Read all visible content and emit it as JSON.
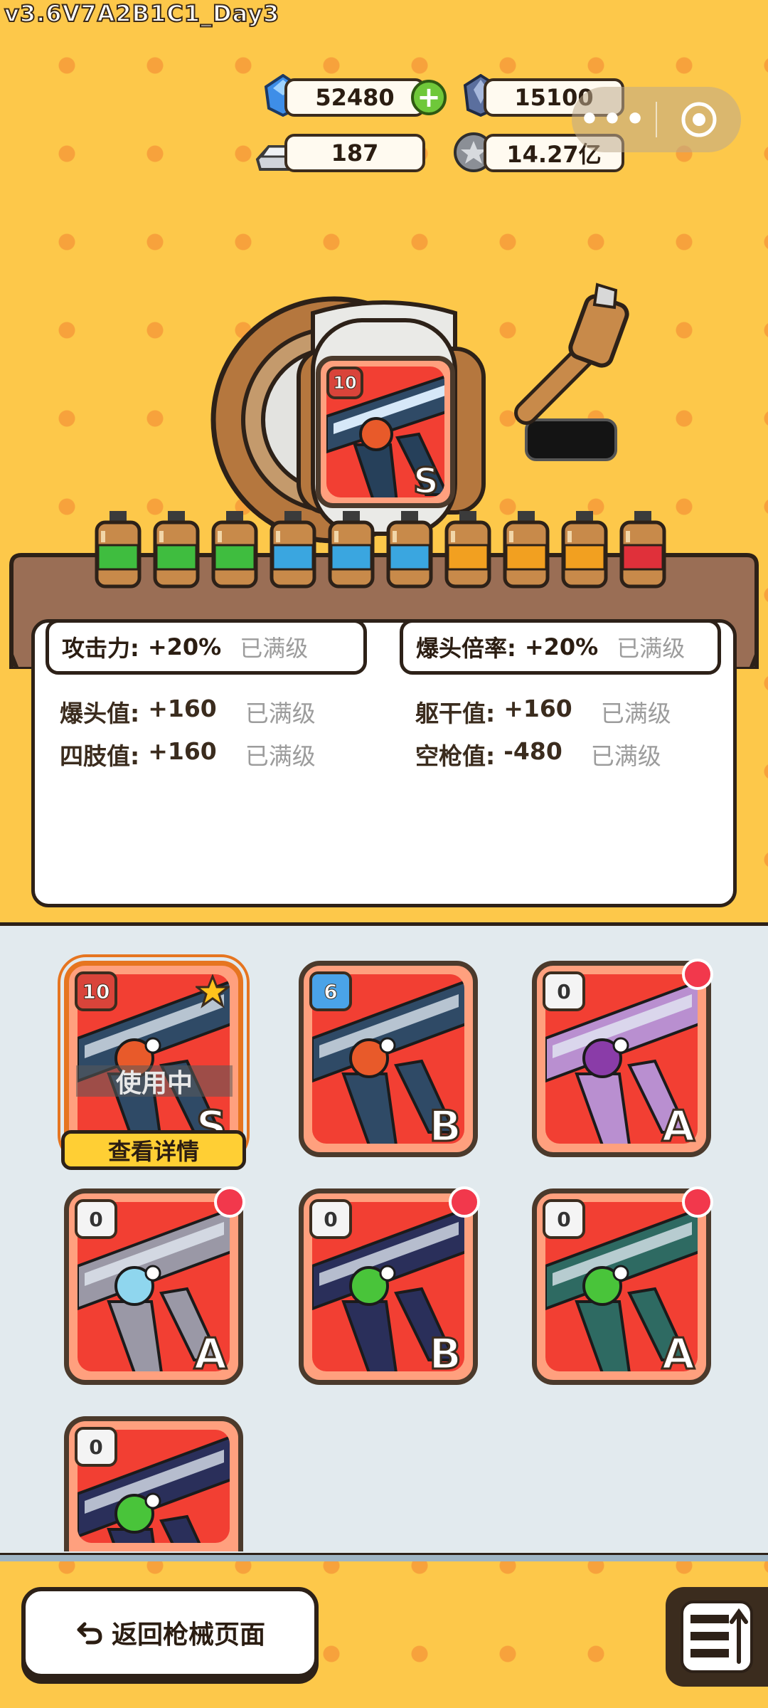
{
  "version": "v3.6V7A2B1C1_Day3",
  "currencies": {
    "diamond": "52480",
    "crystal": "15100",
    "silver": "187",
    "coin": "14.27亿",
    "plus": "+"
  },
  "capsule": {
    "more": "•••"
  },
  "featured_gun": {
    "level": "10",
    "grade": "S"
  },
  "top_stats": [
    {
      "label": "攻击力:",
      "value": "+20%",
      "status": "已满级"
    },
    {
      "label": "爆头倍率:",
      "value": "+20%",
      "status": "已满级"
    }
  ],
  "stats": [
    {
      "label": "爆头值:",
      "value": "+160",
      "status": "已满级"
    },
    {
      "label": "躯干值:",
      "value": "+160",
      "status": "已满级"
    },
    {
      "label": "四肢值:",
      "value": "+160",
      "status": "已满级"
    },
    {
      "label": "空枪值:",
      "value": "-480",
      "status": "已满级"
    }
  ],
  "inventory": [
    {
      "level": "10",
      "grade": "S",
      "badge": "red",
      "in_use": "使用中",
      "selected": true,
      "new": false,
      "skull": "#e85a2a",
      "gun": "#2f4a66"
    },
    {
      "level": "6",
      "grade": "B",
      "badge": "blue",
      "selected": false,
      "new": false,
      "skull": "#e85a2a",
      "gun": "#2f4a66"
    },
    {
      "level": "0",
      "grade": "A",
      "badge": "gray",
      "selected": false,
      "new": true,
      "skull": "#8a3ca8",
      "gun": "#b98fd0"
    },
    {
      "level": "0",
      "grade": "A",
      "badge": "gray",
      "selected": false,
      "new": true,
      "skull": "#8fd6ee",
      "gun": "#9a98a6"
    },
    {
      "level": "0",
      "grade": "B",
      "badge": "gray",
      "selected": false,
      "new": true,
      "skull": "#49c43a",
      "gun": "#2a2f5a"
    },
    {
      "level": "0",
      "grade": "A",
      "badge": "gray",
      "selected": false,
      "new": true,
      "skull": "#49c43a",
      "gun": "#2e6a62"
    },
    {
      "level": "0",
      "grade": "",
      "badge": "gray",
      "selected": false,
      "new": false,
      "skull": "#49c43a",
      "gun": "#2a2f5a"
    }
  ],
  "detail_button": "查看详情",
  "back_button": "返回枪械页面",
  "ammo_colors": [
    "#3fbd3f",
    "#3fbd3f",
    "#3fbd3f",
    "#3aa6e0",
    "#3aa6e0",
    "#3aa6e0",
    "#f2a020",
    "#f2a020",
    "#f2a020",
    "#e0303a"
  ]
}
